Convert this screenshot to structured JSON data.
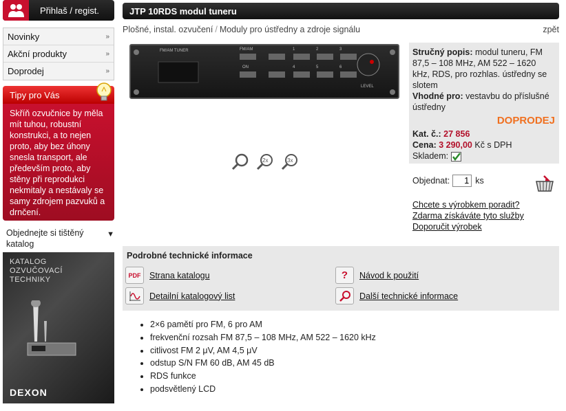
{
  "login": {
    "label": "Přihlaš / regist."
  },
  "menu": [
    {
      "label": "Novinky"
    },
    {
      "label": "Akční produkty"
    },
    {
      "label": "Doprodej"
    }
  ],
  "tips": {
    "title": "Tipy pro Vás",
    "text": "Skříň ozvučnice by měla mít tuhou, robustní konstrukci, a to nejen proto, aby bez úhony snesla transport, ale především proto, aby stěny při reprodukci nekmitaly a nestávaly se samy zdrojem pazvuků a drnčení."
  },
  "catalog": {
    "label": "Objednejte si tištěný katalog",
    "image_lines": [
      "KATALOG",
      "OZVUČOVACÍ",
      "TECHNIKY"
    ],
    "brand": "DEXON"
  },
  "product": {
    "title": "JTP 10RDS modul tuneru",
    "breadcrumb": [
      "Plošné, instal. ozvučení",
      "Moduly pro ústředny a zdroje signálu"
    ],
    "back": "zpět",
    "device_labels": {
      "panel": "FM/AM TUNER",
      "fmam": "FM/AM",
      "on": "ON",
      "level": "LEVEL",
      "presets": [
        "1",
        "2",
        "3",
        "4",
        "5",
        "6"
      ]
    },
    "short_desc_label": "Stručný popis:",
    "short_desc": "modul tuneru, FM 87,5 – 108 MHz, AM 522 – 1620 kHz, RDS, pro rozhlas. ústředny se slotem",
    "suitable_label": "Vhodné pro:",
    "suitable": "vestavbu do příslušné ústředny",
    "status": "DOPRODEJ",
    "cat_label": "Kat. č.:",
    "cat_no": "27 856",
    "price_label": "Cena:",
    "price": "3 290,00",
    "price_suffix": "Kč s DPH",
    "stock_label": "Skladem:",
    "order_label": "Objednat:",
    "order_qty": "1",
    "order_unit": "ks",
    "links": [
      "Chcete s výrobkem poradit?",
      "Zdarma získáváte tyto služby",
      "Doporučit výrobek"
    ]
  },
  "tech": {
    "title": "Podrobné technické informace",
    "items": [
      {
        "icon_text": "PDF",
        "label": "Strana katalogu"
      },
      {
        "icon_text": "?",
        "label": "Návod k použití"
      },
      {
        "label": "Detailní katalogový list"
      },
      {
        "label": "Další technické informace"
      }
    ]
  },
  "zoom": {
    "z2": "2x",
    "z3": "3x"
  },
  "specs": [
    "2×6 pamětí pro FM, 6 pro AM",
    "frekvenční rozsah FM 87,5 – 108 MHz, AM 522 – 1620 kHz",
    "citlivost FM 2 μV, AM 4,5 μV",
    "odstup S/N FM 60 dB, AM 45 dB",
    "RDS funkce",
    "podsvětlený LCD"
  ]
}
